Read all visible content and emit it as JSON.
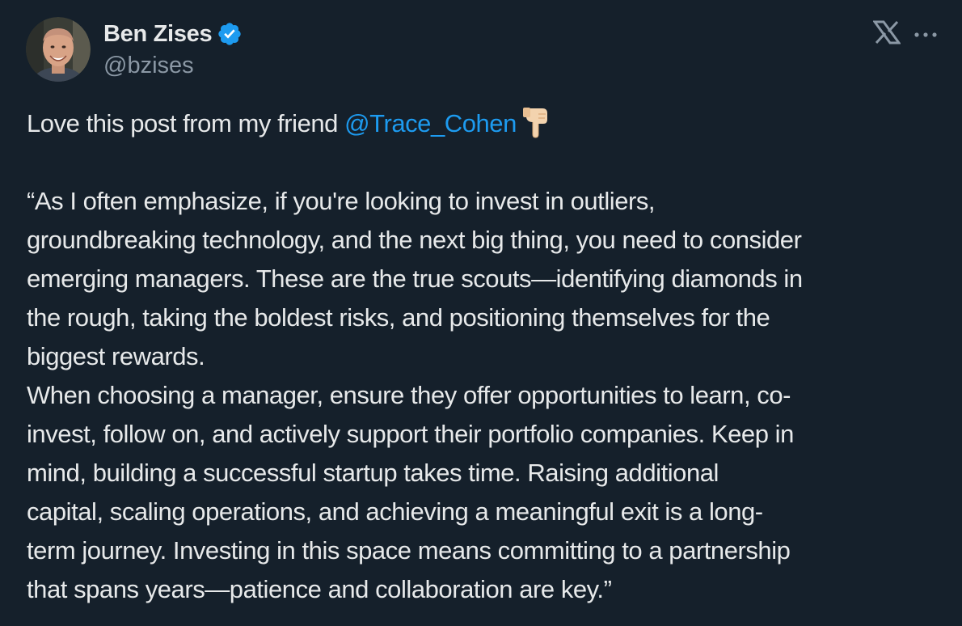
{
  "author": {
    "display_name": "Ben Zises",
    "handle": "@bzises",
    "verified": true,
    "avatar": "avatar"
  },
  "icons": {
    "verified": "verified-badge-icon",
    "x_logo": "x-logo-icon",
    "more": "more-options-icon",
    "emoji": "backhand-index-pointing-down-emoji"
  },
  "colors": {
    "background": "#15202b",
    "text": "#e7e9ea",
    "secondary": "#8b98a5",
    "mention": "#1d9bf0",
    "verified": "#1d9bf0"
  },
  "tweet": {
    "intro_prefix": "Love this post from my friend ",
    "mention": "@Trace_Cohen",
    "lines": [
      "“As I often emphasize, if you're looking to invest in outliers,",
      "groundbreaking technology, and the next big thing, you need to consider",
      "emerging managers. These are the true scouts—identifying diamonds in",
      "the rough, taking the boldest risks, and positioning themselves for the",
      "biggest rewards.",
      "When choosing a manager, ensure they offer opportunities to learn, co-",
      "invest, follow on, and actively support their portfolio companies. Keep in",
      "mind, building a successful startup takes time. Raising additional",
      "capital, scaling operations, and achieving a meaningful exit is a long-",
      "term journey. Investing in this space means committing to a partnership",
      "that spans years—patience and collaboration are key.”"
    ]
  }
}
